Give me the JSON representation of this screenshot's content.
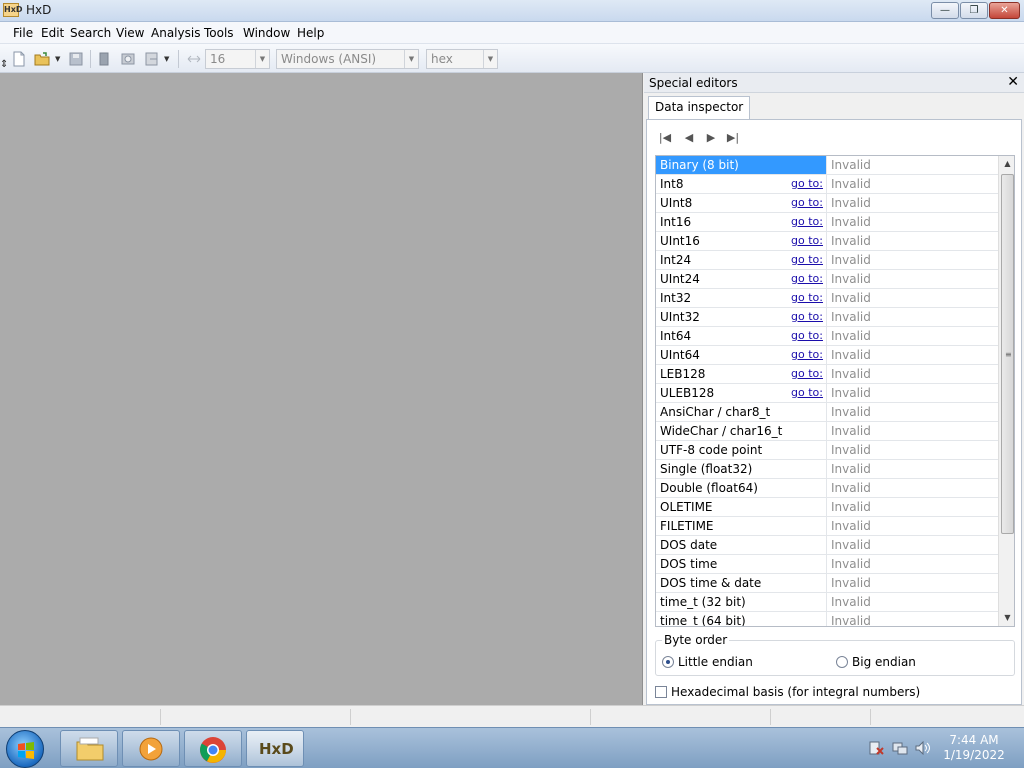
{
  "window": {
    "title": "HxD",
    "app_icon_text": "HxD"
  },
  "menu": [
    "File",
    "Edit",
    "Search",
    "View",
    "Analysis",
    "Tools",
    "Window",
    "Help"
  ],
  "toolbar": {
    "bytes_per_row": "16",
    "encoding": "Windows (ANSI)",
    "offset_base": "hex"
  },
  "panel": {
    "title": "Special editors",
    "tab": "Data inspector",
    "goto_label": "go to:",
    "rows": [
      {
        "type": "Binary (8 bit)",
        "value": "Invalid",
        "goto": false
      },
      {
        "type": "Int8",
        "value": "Invalid",
        "goto": true
      },
      {
        "type": "UInt8",
        "value": "Invalid",
        "goto": true
      },
      {
        "type": "Int16",
        "value": "Invalid",
        "goto": true
      },
      {
        "type": "UInt16",
        "value": "Invalid",
        "goto": true
      },
      {
        "type": "Int24",
        "value": "Invalid",
        "goto": true
      },
      {
        "type": "UInt24",
        "value": "Invalid",
        "goto": true
      },
      {
        "type": "Int32",
        "value": "Invalid",
        "goto": true
      },
      {
        "type": "UInt32",
        "value": "Invalid",
        "goto": true
      },
      {
        "type": "Int64",
        "value": "Invalid",
        "goto": true
      },
      {
        "type": "UInt64",
        "value": "Invalid",
        "goto": true
      },
      {
        "type": "LEB128",
        "value": "Invalid",
        "goto": true
      },
      {
        "type": "ULEB128",
        "value": "Invalid",
        "goto": true
      },
      {
        "type": "AnsiChar / char8_t",
        "value": "Invalid",
        "goto": false
      },
      {
        "type": "WideChar / char16_t",
        "value": "Invalid",
        "goto": false
      },
      {
        "type": "UTF-8 code point",
        "value": "Invalid",
        "goto": false
      },
      {
        "type": "Single (float32)",
        "value": "Invalid",
        "goto": false
      },
      {
        "type": "Double (float64)",
        "value": "Invalid",
        "goto": false
      },
      {
        "type": "OLETIME",
        "value": "Invalid",
        "goto": false
      },
      {
        "type": "FILETIME",
        "value": "Invalid",
        "goto": false
      },
      {
        "type": "DOS date",
        "value": "Invalid",
        "goto": false
      },
      {
        "type": "DOS time",
        "value": "Invalid",
        "goto": false
      },
      {
        "type": "DOS time & date",
        "value": "Invalid",
        "goto": false
      },
      {
        "type": "time_t (32 bit)",
        "value": "Invalid",
        "goto": false
      },
      {
        "type": "time_t (64 bit)",
        "value": "Invalid",
        "goto": false
      }
    ],
    "byte_order": {
      "label": "Byte order",
      "little": "Little endian",
      "big": "Big endian",
      "selected": "little"
    },
    "hex_basis": "Hexadecimal basis (for integral numbers)"
  },
  "taskbar": {
    "clock_time": "7:44 AM",
    "clock_date": "1/19/2022",
    "hxd_icon_text": "HxD"
  },
  "colors": {
    "selection": "#3399ff",
    "workspace": "#ababab",
    "link": "#1a0dab"
  }
}
